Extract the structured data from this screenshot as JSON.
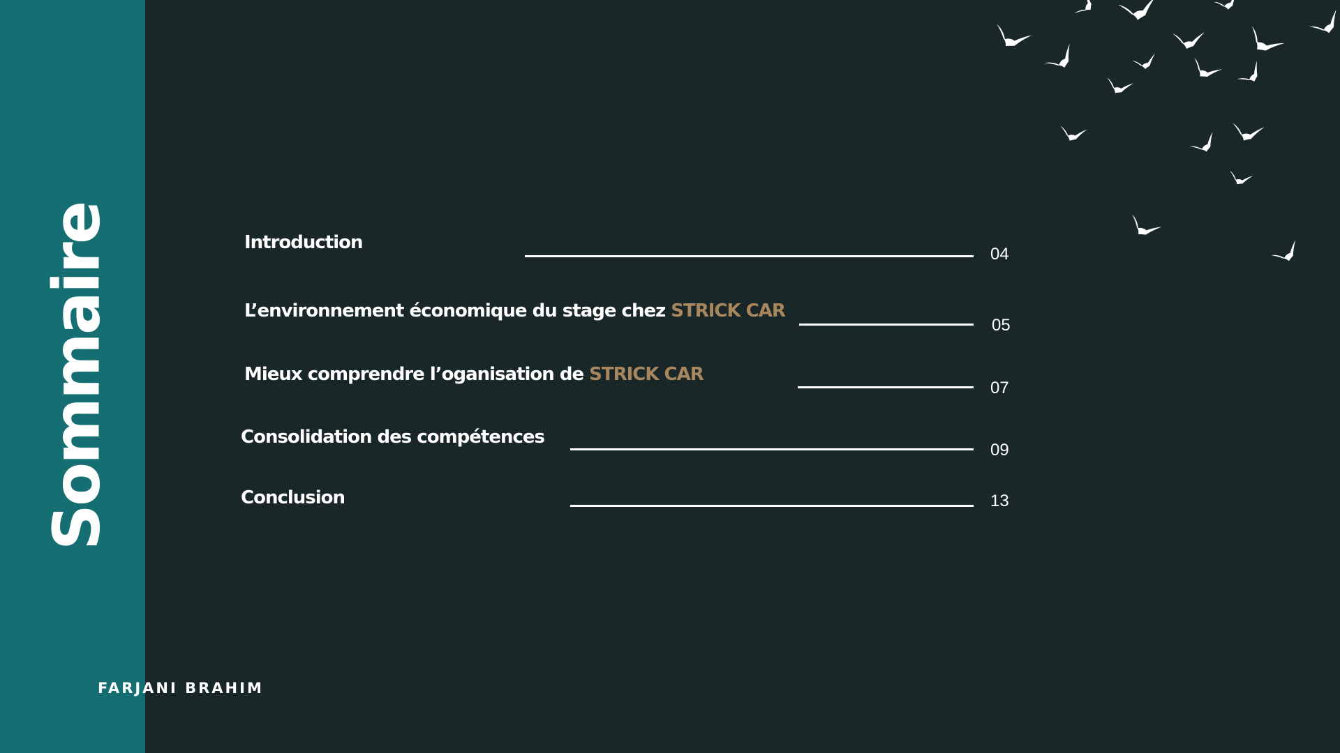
{
  "slide": {
    "title": "Sommaire",
    "author": "FARJANI BRAHIM",
    "colors": {
      "background": "#1a2728",
      "sidebar": "#146e72",
      "text": "#ffffff",
      "accent": "#a8865e"
    },
    "decoration": "flying-birds-icon"
  },
  "toc": [
    {
      "label": "Introduction",
      "highlight": "",
      "page": "04"
    },
    {
      "label": "L’environnement économique du stage chez ",
      "highlight": "STRICK CAR",
      "page": "05"
    },
    {
      "label": "Mieux comprendre l’oganisation de ",
      "highlight": "STRICK CAR",
      "page": "07"
    },
    {
      "label": "Consolidation des compétences",
      "highlight": "",
      "page": "09"
    },
    {
      "label": "Conclusion",
      "highlight": "",
      "page": "13"
    }
  ]
}
